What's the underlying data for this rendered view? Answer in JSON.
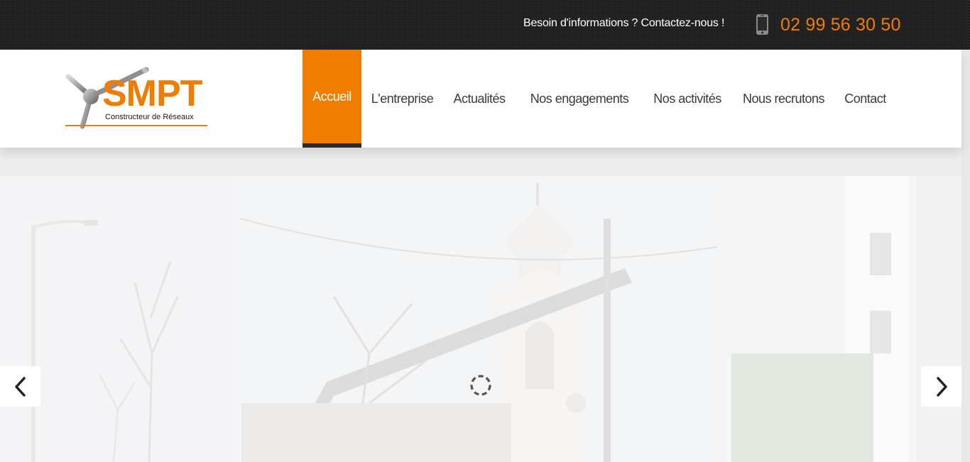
{
  "topbar": {
    "info_text": "Besoin d'informations ? Contactez-nous !",
    "phone_icon": "mobile-phone-icon",
    "phone_number": "02 99 56 30 50"
  },
  "logo": {
    "name": "SMPT",
    "tagline": "Constructeur de Réseaux"
  },
  "nav": {
    "items": [
      {
        "label": "Accueil",
        "active": true
      },
      {
        "label": "L'entreprise"
      },
      {
        "label": "Actualités"
      },
      {
        "label": "Nos engagements"
      },
      {
        "label": "Nos activités"
      },
      {
        "label": "Nous recrutons"
      },
      {
        "label": "Contact"
      }
    ]
  },
  "slider": {
    "prev_icon": "chevron-left-icon",
    "next_icon": "chevron-right-icon",
    "loader_icon": "loading-spinner-icon"
  },
  "colors": {
    "accent": "#f07d00",
    "topbar_bg": "#1c1c1c",
    "nav_text": "#3a3a3a"
  }
}
